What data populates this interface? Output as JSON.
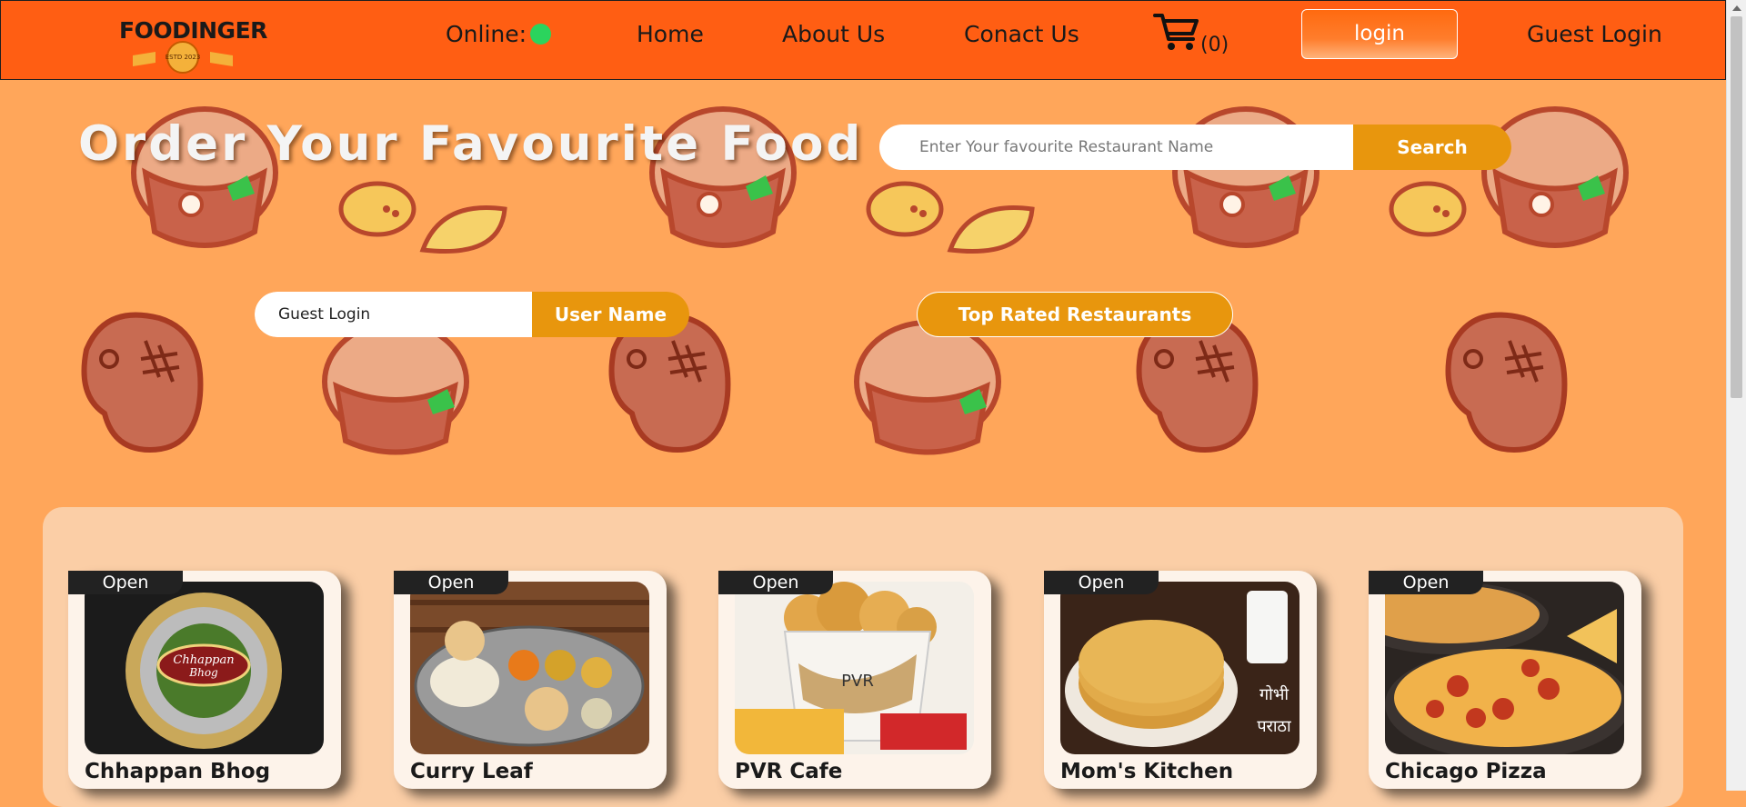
{
  "header": {
    "logo_text": "FOODINGER",
    "logo_badge": "ESTD 2023",
    "online_label": "Online:",
    "online_color": "#2bd45d",
    "nav": [
      "Home",
      "About Us",
      "Conact Us"
    ],
    "cart_count": "(0)",
    "login_label": "login",
    "guest_login_label": "Guest Login"
  },
  "hero": {
    "title": "Order Your Favourite Food",
    "search_placeholder": "Enter Your favourite Restaurant Name",
    "search_button": "Search",
    "user_field_value": "Guest Login",
    "username_button": "User Name",
    "top_rated_button": "Top Rated Restaurants"
  },
  "restaurants": [
    {
      "name": "Chhappan Bhog",
      "status": "Open",
      "image": "sweets-platter-image"
    },
    {
      "name": "Curry Leaf",
      "status": "Open",
      "image": "thali-image"
    },
    {
      "name": "PVR Cafe",
      "status": "Open",
      "image": "popcorn-image"
    },
    {
      "name": "Mom's Kitchen",
      "status": "Open",
      "image": "paratha-image"
    },
    {
      "name": "Chicago Pizza",
      "status": "Open",
      "image": "pizza-image"
    }
  ],
  "theme": {
    "navbar": "#ff5e13",
    "background": "#ffa65a",
    "accent": "#e8960d"
  }
}
